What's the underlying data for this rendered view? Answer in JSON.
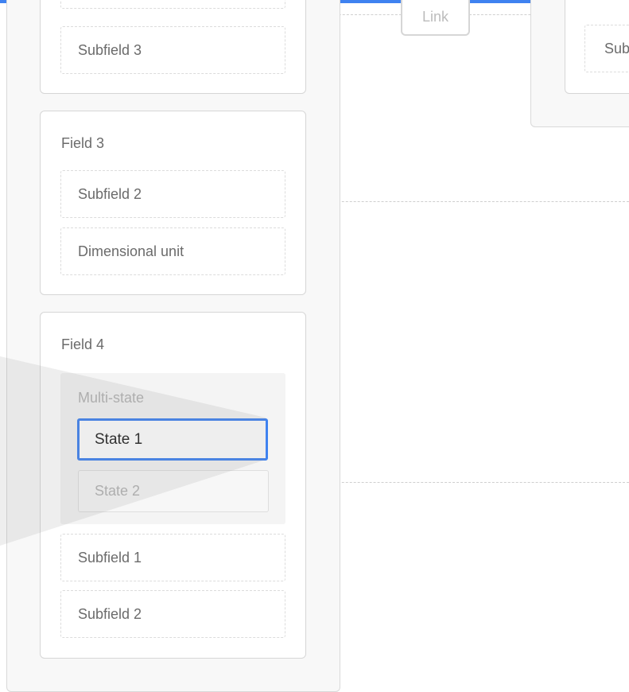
{
  "link": {
    "label": "Link"
  },
  "cards": {
    "card_top": {
      "subfield_3": "Subfield 3"
    },
    "field_3": {
      "title": "Field 3",
      "subfield_2": "Subfield 2",
      "dimensional_unit": "Dimensional unit"
    },
    "field_4": {
      "title": "Field 4",
      "multistate_label": "Multi-state",
      "state_1": "State 1",
      "state_2": "State 2",
      "subfield_1": "Subfield 1",
      "subfield_2": "Subfield 2"
    }
  },
  "right_panel": {
    "subfield_partial": "Sub"
  },
  "colors": {
    "accent": "#3f82f0",
    "border": "#d6d6d6",
    "text": "#6b6b6b",
    "muted_text": "#b4b4b4"
  }
}
